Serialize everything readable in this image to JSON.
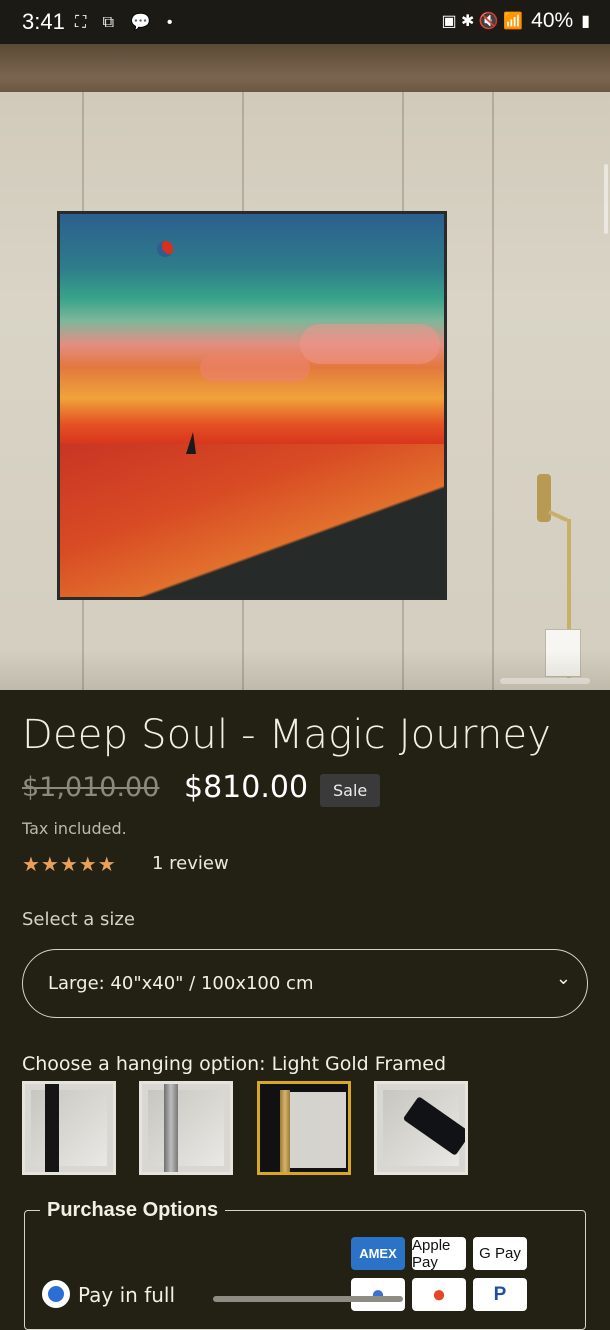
{
  "status_bar": {
    "time": "3:41",
    "left_icons": "⛶ ⧉ 💬 •",
    "battery": "40%",
    "right_icons": "▣ ✱ 🔇 📶"
  },
  "product": {
    "title": "Deep Soul - Magic Journey",
    "old_price": "$1,010.00",
    "price": "$810.00",
    "sale_badge": "Sale",
    "tax_note": "Tax included.",
    "stars": "★★★★★",
    "rating": 5,
    "review_count": "1 review",
    "size_label": "Select a size",
    "size_value": "Large: 40\"x40\" / 100x100 cm",
    "hanging_label": "Choose a hanging option: Light Gold Framed",
    "hanging_options": [
      "Black Framed",
      "Silver Framed",
      "Light Gold Framed",
      "Rolled"
    ],
    "selected_hanging": "Light Gold Framed"
  },
  "purchase": {
    "legend": "Purchase Options",
    "pay_in_full": "Pay in full",
    "methods_row1": [
      "AMEX",
      "Apple Pay",
      "G Pay"
    ],
    "methods_row2": [
      "Maestro",
      "Mastercard",
      "P"
    ]
  },
  "colors": {
    "background": "#232114",
    "accent_selected": "#d9a822",
    "stars": "#e8a05a",
    "radio": "#2b6fd6"
  }
}
